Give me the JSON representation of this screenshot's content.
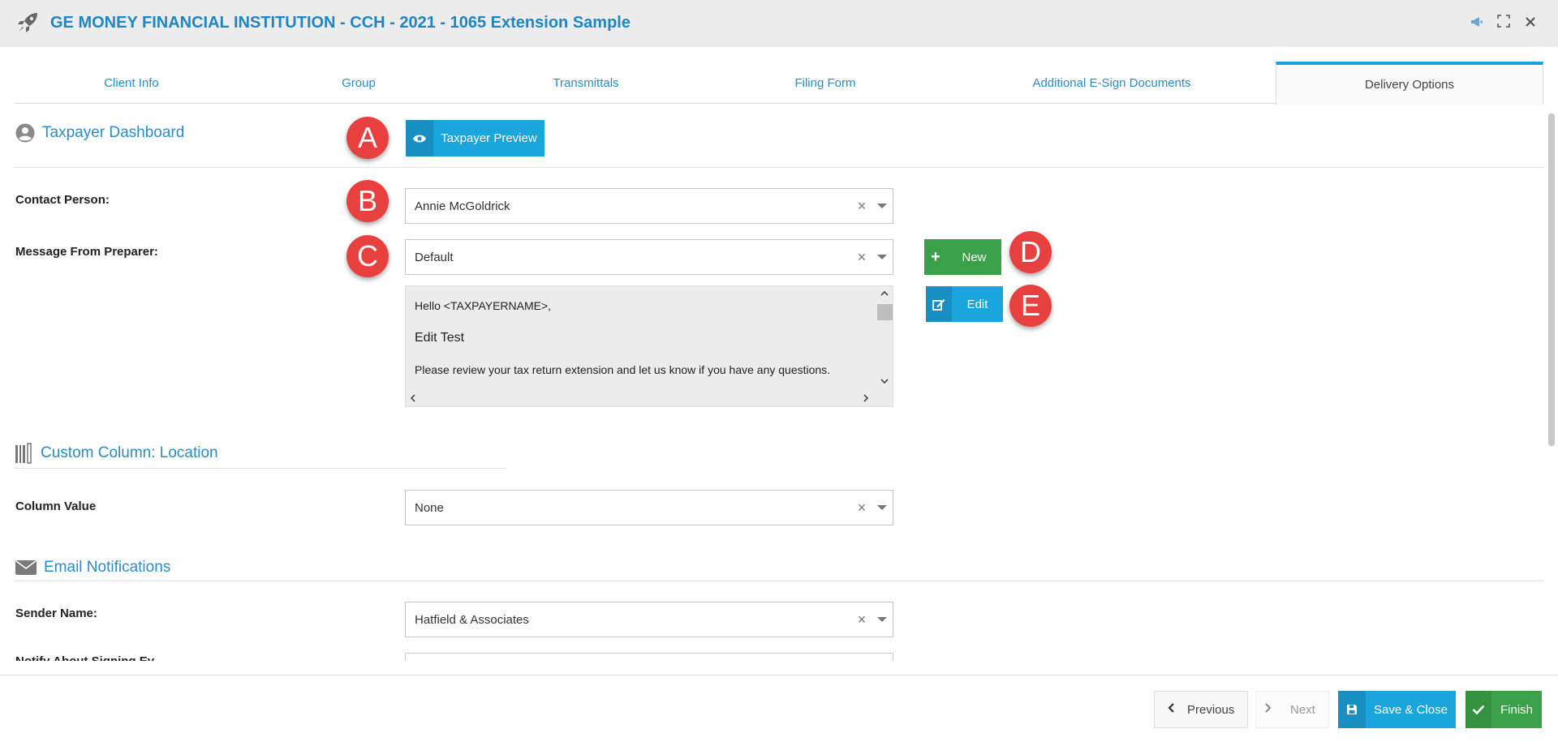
{
  "window": {
    "title": "GE MONEY FINANCIAL INSTITUTION - CCH - 2021 - 1065 Extension Sample",
    "icons": [
      "rocket-icon",
      "megaphone-icon",
      "expand-icon",
      "close-icon"
    ]
  },
  "tabs": [
    {
      "label": "Client Info",
      "active": false
    },
    {
      "label": "Group",
      "active": false
    },
    {
      "label": "Transmittals",
      "active": false
    },
    {
      "label": "Filing Form",
      "active": false
    },
    {
      "label": "Additional E-Sign Documents",
      "active": false
    },
    {
      "label": "Delivery Options",
      "active": true
    }
  ],
  "taxpayer_dashboard": {
    "title": "Taxpayer Dashboard",
    "icon": "user-circle-icon",
    "preview_button": "Taxpayer Preview",
    "contact_person_label": "Contact Person:",
    "contact_person_value": "Annie McGoldrick",
    "message_label": "Message From Preparer:",
    "message_value": "Default",
    "new_button": "New",
    "edit_button": "Edit",
    "message_lines": [
      "Hello <TAXPAYERNAME>,",
      "Edit Test",
      "Please review your tax return extension and let us know if you have any questions."
    ]
  },
  "custom_column": {
    "title": "Custom Column: Location",
    "column_value_label": "Column Value",
    "column_value": "None"
  },
  "email_notifications": {
    "title": "Email Notifications",
    "sender_name_label": "Sender Name:",
    "sender_name_value": "Hatfield & Associates",
    "next_label_partial": "Notify About Signing Ev"
  },
  "badges": [
    "A",
    "B",
    "C",
    "D",
    "E"
  ],
  "footer": {
    "previous": "Previous",
    "next": "Next",
    "save_close": "Save & Close",
    "finish": "Finish"
  },
  "colors": {
    "brand_blue": "#1f86c1",
    "accent_blue": "#1aa0e0",
    "green": "#3aa04a",
    "badge_red": "#e8403e"
  }
}
